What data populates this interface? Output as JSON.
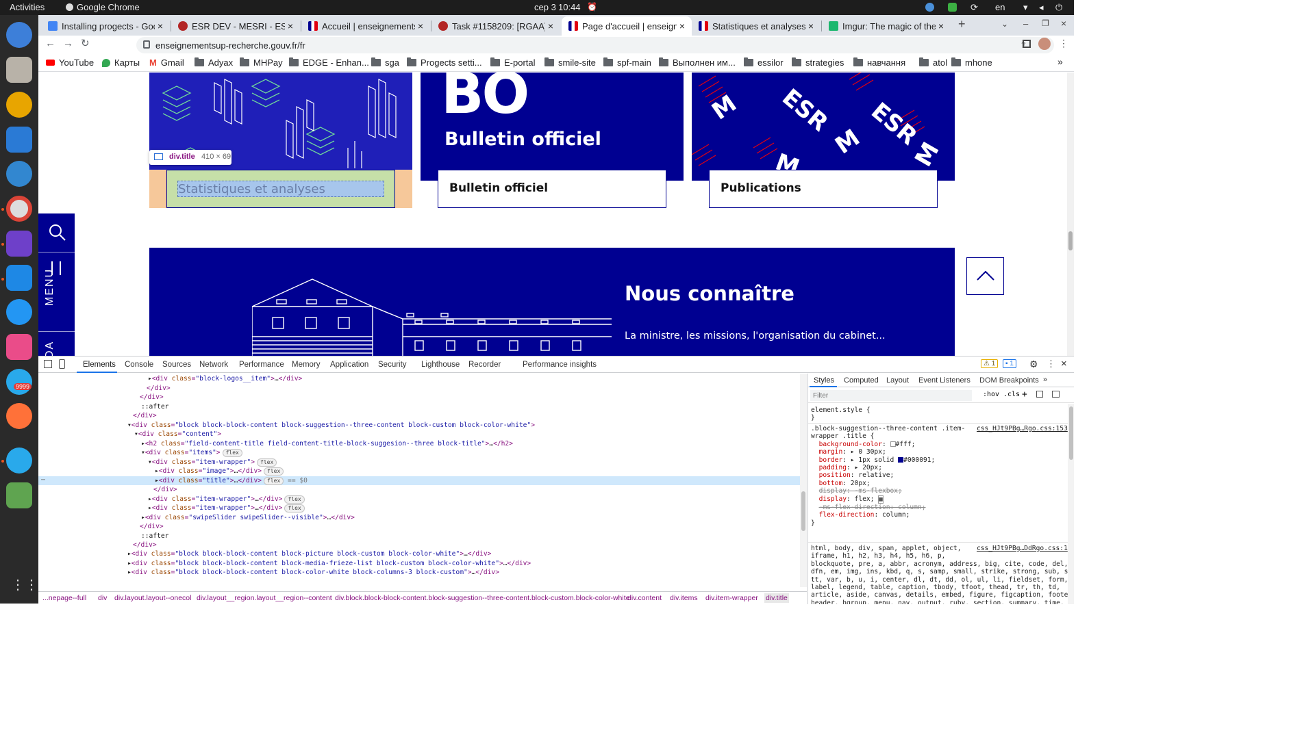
{
  "os": {
    "activities": "Activities",
    "app_name": "Google Chrome",
    "date": "сер 3",
    "time": "10:44",
    "lang": "en",
    "dock_badge": "9999"
  },
  "tabs": [
    {
      "label": "Installing progects - Goo",
      "active": false
    },
    {
      "label": "ESR DEV - MESRI - ESR/H",
      "active": false
    },
    {
      "label": "Accueil | enseignements",
      "active": false
    },
    {
      "label": "Task #1158209: [RGAA] H",
      "active": false
    },
    {
      "label": "Page d'accueil | enseigne",
      "active": true
    },
    {
      "label": "Statistiques et analyses",
      "active": false
    },
    {
      "label": "Imgur: The magic of the I",
      "active": false
    }
  ],
  "address": "enseignementsup-recherche.gouv.fr/fr",
  "bookmarks": [
    "YouTube",
    "Карты",
    "Gmail",
    "Adyax",
    "MHPay",
    "EDGE - Enhan...",
    "sga",
    "Progects setti...",
    "E-portal",
    "smile-site",
    "spf-main",
    "Выполнен им...",
    "essilor",
    "strategies",
    "навчання",
    "atol",
    "mhone"
  ],
  "page": {
    "bo_big": "BO",
    "bo_sub": "Bulletin officiel",
    "card1_title": "Statistiques et analyses",
    "card2_title": "Bulletin officiel",
    "card3_title": "Publications",
    "tooltip_name": "div.title",
    "tooltip_size": "410 × 69",
    "menu_label": "MENU",
    "side_label": "DA",
    "section_title": "Nous connaître",
    "section_desc": "La ministre, les missions, l'organisation du cabinet..."
  },
  "devtools": {
    "tabs": [
      "Elements",
      "Console",
      "Sources",
      "Network",
      "Performance",
      "Memory",
      "Application",
      "Security",
      "Lighthouse",
      "Recorder",
      "Performance insights"
    ],
    "warn_count": "1",
    "msg_count": "1",
    "style_tabs": [
      "Styles",
      "Computed",
      "Layout",
      "Event Listeners",
      "DOM Breakpoints"
    ],
    "filter_placeholder": "Filter",
    "hov": ":hov",
    "cls": ".cls",
    "eq_dollar": "== $0",
    "breadcrumbs": [
      "...nepage--full",
      "div",
      "div.layout.layout--onecol",
      "div.layout__region.layout__region--content",
      "div.block.block-block-content.block-suggestion--three-content.block-custom.block-color-white",
      "div.content",
      "div.items",
      "div.item-wrapper",
      "div.title"
    ]
  }
}
